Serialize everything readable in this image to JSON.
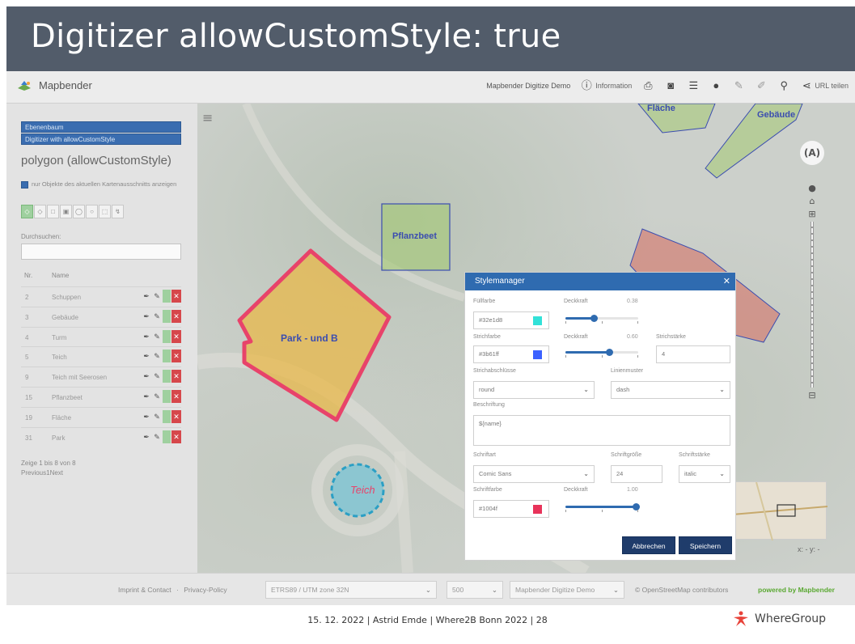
{
  "slide": {
    "title": "Digitizer allowCustomStyle: true",
    "footer": "15. 12. 2022 | Astrid Emde | Where2B Bonn 2022 | 28",
    "brand": "WhereGroup"
  },
  "app": {
    "logo_text": "Mapbender",
    "toolbar": {
      "app_title": "Mapbender Digitize Demo",
      "information": "Information",
      "share": "URL teilen",
      "icons": [
        "info-icon",
        "print-icon",
        "camera-icon",
        "list-icon",
        "globe-icon",
        "ruler-icon",
        "measure-area-icon",
        "pin-icon",
        "share-icon"
      ]
    }
  },
  "sidebar": {
    "accordion": [
      "Ebenenbaum",
      "Digitizer with allowCustomStyle"
    ],
    "schema_title": "polygon (allowCustomStyle)",
    "checkbox_label": "nur Objekte des aktuellen Kartenausschnitts anzeigen",
    "search_label": "Durchsuchen:",
    "search_value": "",
    "table_headers": {
      "nr": "Nr.",
      "name": "Name"
    },
    "rows": [
      {
        "nr": "2",
        "name": "Schuppen"
      },
      {
        "nr": "3",
        "name": "Gebäude"
      },
      {
        "nr": "4",
        "name": "Turm"
      },
      {
        "nr": "5",
        "name": "Teich"
      },
      {
        "nr": "9",
        "name": "Teich mit Seerosen"
      },
      {
        "nr": "15",
        "name": "Pflanzbeet"
      },
      {
        "nr": "19",
        "name": "Fläche"
      },
      {
        "nr": "31",
        "name": "Park"
      }
    ],
    "count_text": "Zeige 1 bis 8 von 8",
    "pager_text": "Previous1Next"
  },
  "map": {
    "labels": {
      "park": "Park - und B",
      "pflanzbeet": "Pflanzbeet",
      "teich": "Teich",
      "flaeche": "Fläche",
      "gebaeude": "Gebäude"
    },
    "coords": "x: - y: -",
    "colors": {
      "park_fill": "#e8b84a",
      "park_stroke": "#e8436a",
      "teich_fill": "#78c4d6",
      "teich_stroke": "#2b9fc4",
      "poly_stroke": "#3b4db0",
      "poly_fill": "#a6c97a",
      "building_fill": "#d47a6e"
    }
  },
  "dialog": {
    "title": "Stylemanager",
    "fill_color_label": "Füllfarbe",
    "fill_color_value": "#32e1d8",
    "fill_color": "#32e1d8",
    "fill_opacity_label": "Deckkraft",
    "fill_opacity": "0.38",
    "stroke_color_label": "Strichfarbe",
    "stroke_color_value": "#3b61ff",
    "stroke_color": "#3b61ff",
    "stroke_opacity_label": "Deckkraft",
    "stroke_opacity": "0.60",
    "stroke_width_label": "Strichstärke",
    "stroke_width_value": "4",
    "linecap_label": "Strichabschlüsse",
    "linecap_value": "round",
    "dash_label": "Linienmuster",
    "dash_value": "dash",
    "label_label": "Beschriftung",
    "label_value": "${name}",
    "font_label": "Schriftart",
    "font_value": "Comic Sans",
    "font_size_label": "Schriftgröße",
    "font_size_value": "24",
    "font_weight_label": "Schriftstärke",
    "font_weight_value": "italic",
    "font_color_label": "Schriftfarbe",
    "font_color_value": "#1004f",
    "font_color": "#e8335a",
    "font_opacity_label": "Deckkraft",
    "font_opacity": "1.00",
    "cancel": "Abbrechen",
    "save": "Speichern"
  },
  "footer": {
    "imprint": "Imprint & Contact",
    "privacy": "Privacy-Policy",
    "srs": "ETRS89 / UTM zone 32N",
    "scale": "500",
    "app_select": "Mapbender Digitize Demo",
    "attribution": "© OpenStreetMap contributors",
    "powered": "powered by Mapbender"
  }
}
